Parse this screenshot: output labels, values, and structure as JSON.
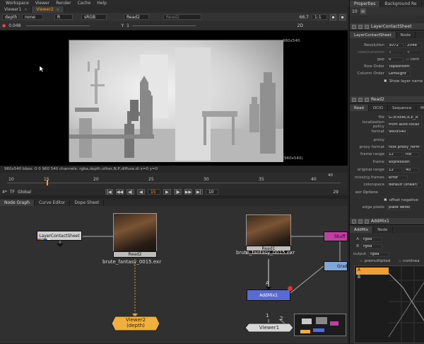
{
  "menu": [
    "Workspace",
    "Viewer",
    "Render",
    "Cache",
    "Help"
  ],
  "viewer_tabs": [
    {
      "label": "Viewer1",
      "active": false
    },
    {
      "label": "Viewer2",
      "active": true
    }
  ],
  "viewer_toolbar": {
    "channels": "depth",
    "channel2": "none",
    "channel3": "R",
    "colorspace": "sRGB",
    "input_a": "Read2",
    "input_b": "Read2",
    "zoom": "66.7",
    "ratio": "1:1",
    "mode": "2D",
    "gain": "0.048",
    "gamma_label": "Y",
    "gamma": "1"
  },
  "viewer": {
    "format_top": "960x540",
    "format_bottom": "(960x540)",
    "info": "960x540  bbox: 0 0 960 540 channels: rgba,depth,other,N,P,diffuse,di  x=0 y=0"
  },
  "timeline": {
    "ticks": [
      "10",
      "15",
      "20",
      "25",
      "30",
      "35",
      "40"
    ],
    "current_frame": "15",
    "start": "12",
    "end": "40",
    "global_label": "Global",
    "step": "10",
    "fps": "29",
    "tf": "TF",
    "rate": "4*"
  },
  "graph_tabs": [
    "Node Graph",
    "Curve Editor",
    "Dope Sheet"
  ],
  "nodes": {
    "layer_contact_sheet": "LayerContactSheet",
    "read2": "Read2",
    "read2_file": "brute_fantasy_0015.exr",
    "read1": "Read1",
    "read1_file": "brute_fantasy_0015.exr",
    "viewer2": "Viewer2",
    "viewer2_sub": "(depth)",
    "addmix1": "AddMix1",
    "shuffle": "Shuff",
    "grade": "Grad",
    "viewer1": "Viewer1",
    "input_a": "A",
    "input_1": "1",
    "input_2": "2"
  },
  "properties": {
    "tabs": [
      "Properties",
      "Background Re"
    ],
    "count": "10",
    "lcs_title": "LayerContactSheet",
    "lcs_tabs": [
      "LayerContactSheet",
      "Node"
    ],
    "resolution_label": "Resolution",
    "resolution_w": "3072",
    "resolution_h": "2048",
    "rows_label": "rows/columns",
    "rows_w": "3",
    "rows_h": "4",
    "gap_label": "gap",
    "gap": "0",
    "center_label": "cent",
    "row_order_label": "Row Order",
    "row_order": "TopBottom",
    "column_order_label": "Column Order",
    "column_order": "LeftRight",
    "show_layer": "Show layer name",
    "read_title": "Read2",
    "read_tabs": [
      "Read",
      "OCIO",
      "Sequence",
      "Me"
    ],
    "file_label": "file",
    "file": "G:/EXERCICE_A",
    "localization_label": "localization policy",
    "localization": "from auto-locali",
    "format_label": "format",
    "format": "960x540",
    "proxy_label": "proxy",
    "proxy_format_label": "proxy format",
    "proxy_format": "root.proxy_form",
    "frame_range_label": "frame range",
    "frame_range_start": "12",
    "frame_range_end": "hol",
    "frame_label": "frame",
    "frame": "expression",
    "original_range_label": "original range",
    "original_start": "12",
    "original_end": "40",
    "missing_label": "missing frames",
    "missing": "error",
    "colorspace_label": "colorspace",
    "colorspace": "default (linear)",
    "exr_options": "exr Options",
    "offset_neg": "offset negative",
    "edge_label": "edge pixels",
    "edge": "plate detect",
    "addmix_title": "AddMix1",
    "addmix_tabs": [
      "AddMix",
      "Node"
    ],
    "a_label": "A",
    "a_value": "rgba",
    "b_label": "B",
    "b_value": "rgba",
    "output_label": "output",
    "output_value": "rgba",
    "premultiplied": "premultiplied",
    "nonlinear": "nonlinea",
    "curve_a": "A",
    "curve_b": "B"
  },
  "colors": {
    "accent_orange": "#f0a030",
    "read_node": "#c8c8c8",
    "addmix_node": "#5a6bd0",
    "viewer_node": "#f0b040",
    "shuffle_node": "#c040a0",
    "grade_node": "#7fa8d8"
  }
}
